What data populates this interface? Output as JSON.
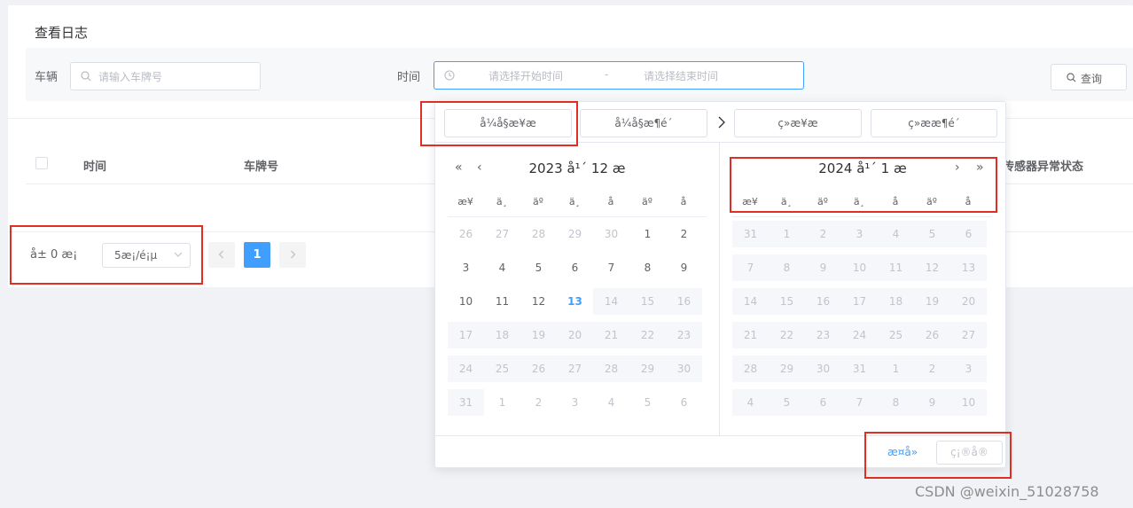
{
  "page_title": "查看日志",
  "filters": {
    "vehicle_label": "车辆",
    "vehicle_placeholder": "请输入车牌号",
    "time_label": "时间",
    "start_placeholder": "请选择开始时间",
    "range_separator": "-",
    "end_placeholder": "请选择结束时间",
    "query_label": "查询"
  },
  "table": {
    "columns": [
      "时间",
      "车牌号",
      "传感器异常状态"
    ]
  },
  "pagination": {
    "total_text": "å± 0 æ¡",
    "page_size_text": "5æ¡/é¡µ",
    "current_page": "1"
  },
  "picker": {
    "start_date_placeholder": "å¼å§æ¥æ",
    "start_time_placeholder": "å¼å§æ¶é´",
    "end_date_placeholder": "ç»æ¥æ",
    "end_time_placeholder": "ç»ææ¶é´",
    "left_title": "2023 å¹´ 12 æ",
    "right_title": "2024 å¹´ 1 æ",
    "weekdays": [
      "æ¥",
      "ä¸",
      "äº",
      "ä¸",
      "å",
      "äº",
      "å"
    ],
    "left_days": [
      [
        "26",
        "27",
        "28",
        "29",
        "30",
        "1",
        "2"
      ],
      [
        "3",
        "4",
        "5",
        "6",
        "7",
        "8",
        "9"
      ],
      [
        "10",
        "11",
        "12",
        "13",
        "14",
        "15",
        "16"
      ],
      [
        "17",
        "18",
        "19",
        "20",
        "21",
        "22",
        "23"
      ],
      [
        "24",
        "25",
        "26",
        "27",
        "28",
        "29",
        "30"
      ],
      [
        "31",
        "1",
        "2",
        "3",
        "4",
        "5",
        "6"
      ]
    ],
    "right_days": [
      [
        "31",
        "1",
        "2",
        "3",
        "4",
        "5",
        "6"
      ],
      [
        "7",
        "8",
        "9",
        "10",
        "11",
        "12",
        "13"
      ],
      [
        "14",
        "15",
        "16",
        "17",
        "18",
        "19",
        "20"
      ],
      [
        "21",
        "22",
        "23",
        "24",
        "25",
        "26",
        "27"
      ],
      [
        "28",
        "29",
        "30",
        "31",
        "1",
        "2",
        "3"
      ],
      [
        "4",
        "5",
        "6",
        "7",
        "8",
        "9",
        "10"
      ]
    ],
    "now_label": "æ­¤å»",
    "confirm_label": "ç¡®å®"
  },
  "watermark": "CSDN @weixin_51028758",
  "colors": {
    "primary": "#409eff",
    "highlight_box": "#e02e24"
  }
}
